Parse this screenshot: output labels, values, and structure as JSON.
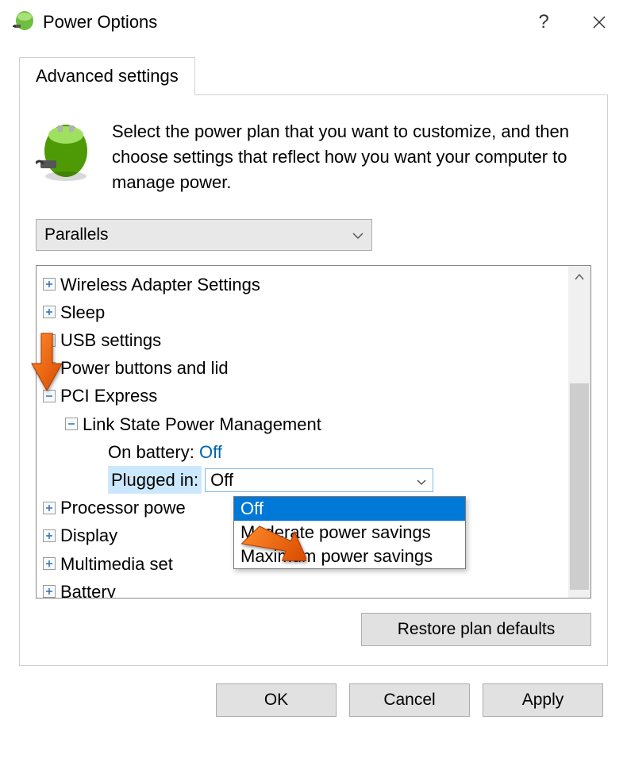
{
  "titlebar": {
    "title": "Power Options"
  },
  "tab": {
    "label": "Advanced settings"
  },
  "description": "Select the power plan that you want to customize, and then choose settings that reflect how you want your computer to manage power.",
  "plan_select": {
    "value": "Parallels"
  },
  "tree": {
    "items": [
      {
        "label": "Wireless Adapter Settings",
        "expanded": false
      },
      {
        "label": "Sleep",
        "expanded": false
      },
      {
        "label": "USB settings",
        "expanded": false
      },
      {
        "label": "Power buttons and lid",
        "expanded": false
      },
      {
        "label": "PCI Express",
        "expanded": true
      },
      {
        "label": "Processor powe",
        "expanded": false
      },
      {
        "label": "Display",
        "expanded": false
      },
      {
        "label": "Multimedia set",
        "expanded": false
      },
      {
        "label": "Battery",
        "expanded": false
      }
    ],
    "pci": {
      "sub_label": "Link State Power Management",
      "on_battery_label": "On battery:",
      "on_battery_value": "Off",
      "plugged_in_label": "Plugged in:",
      "plugged_in_value": "Off"
    }
  },
  "dropdown": {
    "options": [
      "Off",
      "Moderate power savings",
      "Maximum power savings"
    ]
  },
  "buttons": {
    "restore": "Restore plan defaults",
    "ok": "OK",
    "cancel": "Cancel",
    "apply": "Apply"
  }
}
